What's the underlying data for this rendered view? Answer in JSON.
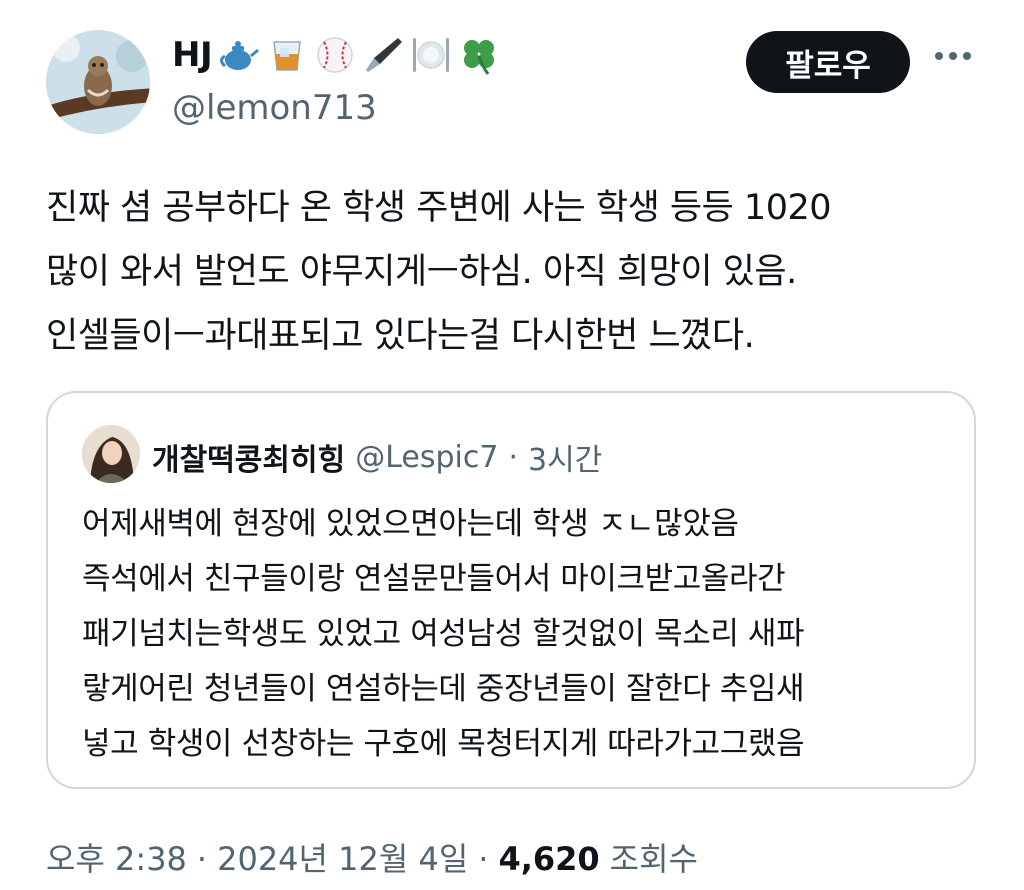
{
  "author": {
    "name": "HJ",
    "handle": "@lemon713",
    "emojis": [
      "teapot-icon",
      "whisky-glass-icon",
      "baseball-icon",
      "fountain-pen-icon",
      "fork-knife-plate-icon",
      "four-leaf-clover-icon"
    ]
  },
  "follow_label": "팔로우",
  "tweet_lines": [
    "진짜 셤 공부하다 온 학생 주변에 사는 학생 등등 1020",
    "많이 와서 발언도 야무지게ㅡ하심. 아직 희망이 있음.",
    "인셀들이ㅡ과대표되고 있다는걸 다시한번 느꼈다."
  ],
  "quote": {
    "name": "개찰떡콩최히힝",
    "handle": "@Lespic7",
    "separator": "·",
    "time": "3시간",
    "lines": [
      "어제새벽에 현장에 있었으면아는데 학생 ㅈㄴ많았음",
      "즉석에서 친구들이랑 연설문만들어서 마이크받고올라간",
      "패기넘치는학생도 있었고 여성남성 할것없이 목소리 새파",
      "랗게어린 청년들이 연설하는데 중장년들이 잘한다 추임새",
      "넣고 학생이 선창하는 구호에 목청터지게 따라가고그랬음"
    ]
  },
  "meta": {
    "time": "오후 2:38",
    "sep1": "·",
    "date": "2024년 12월 4일",
    "sep2": "·",
    "views": "4,620",
    "views_label": "조회수"
  }
}
